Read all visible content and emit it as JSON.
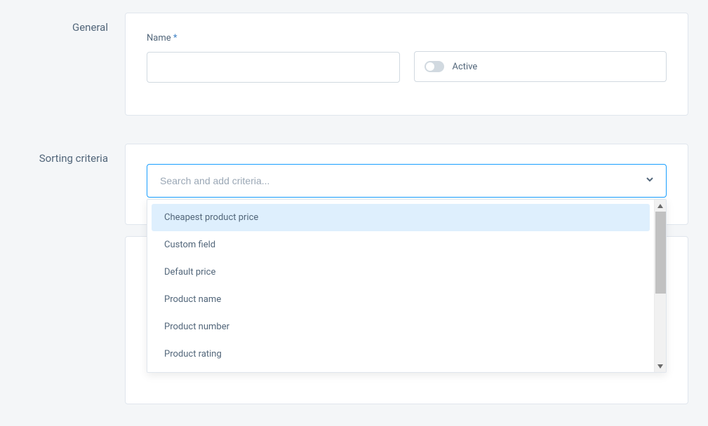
{
  "general": {
    "section_label": "General",
    "name_label": "Name",
    "required_marker": "*",
    "name_value": "",
    "active_label": "Active"
  },
  "sorting": {
    "section_label": "Sorting criteria",
    "search_placeholder": "Search and add criteria...",
    "options": [
      "Cheapest product price",
      "Custom field",
      "Default price",
      "Product name",
      "Product number",
      "Product rating"
    ],
    "highlighted_index": 0
  }
}
